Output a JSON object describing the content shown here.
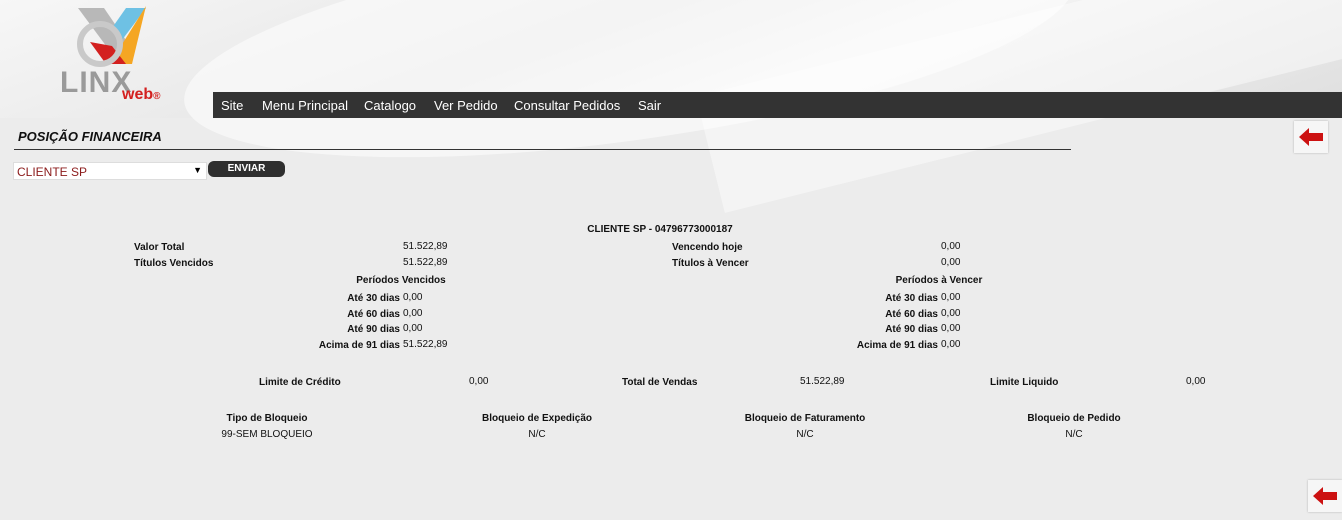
{
  "brand": {
    "name": "LINX",
    "sub": "web",
    "mark": "®"
  },
  "nav": [
    "Site",
    "Menu Principal",
    "Catalogo",
    "Ver Pedido",
    "Consultar Pedidos",
    "Sair"
  ],
  "page_title": "POSIÇÃO FINANCEIRA",
  "filter": {
    "selected": "CLIENTE SP",
    "send_label": "ENVIAR"
  },
  "report": {
    "client_header": "CLIENTE SP - 04796773000187",
    "valor_total": {
      "label": "Valor Total",
      "value": "51.522,89"
    },
    "titulos_vencidos": {
      "label": "Títulos Vencidos",
      "value": "51.522,89"
    },
    "vencendo_hoje": {
      "label": "Vencendo hoje",
      "value": "0,00"
    },
    "titulos_a_vencer": {
      "label": "Títulos à Vencer",
      "value": "0,00"
    },
    "periodos_vencidos": {
      "title": "Períodos Vencidos",
      "rows": [
        {
          "label": "Até 30 dias",
          "value": "0,00"
        },
        {
          "label": "Até 60 dias",
          "value": "0,00"
        },
        {
          "label": "Até 90 dias",
          "value": "0,00"
        },
        {
          "label": "Acima de 91 dias",
          "value": "51.522,89"
        }
      ]
    },
    "periodos_a_vencer": {
      "title": "Períodos à Vencer",
      "rows": [
        {
          "label": "Até 30 dias",
          "value": "0,00"
        },
        {
          "label": "Até 60 dias",
          "value": "0,00"
        },
        {
          "label": "Até 90 dias",
          "value": "0,00"
        },
        {
          "label": "Acima de 91 dias",
          "value": "0,00"
        }
      ]
    },
    "limite_credito": {
      "label": "Limite de Crédito",
      "value": "0,00"
    },
    "total_vendas": {
      "label": "Total de Vendas",
      "value": "51.522,89"
    },
    "limite_liquido": {
      "label": "Limite Liquido",
      "value": "0,00"
    },
    "bloqueios": [
      {
        "label": "Tipo de Bloqueio",
        "value": "99-SEM BLOQUEIO"
      },
      {
        "label": "Bloqueio de Expedição",
        "value": "N/C"
      },
      {
        "label": "Bloqueio de Faturamento",
        "value": "N/C"
      },
      {
        "label": "Bloqueio de Pedido",
        "value": "N/C"
      }
    ]
  },
  "colors": {
    "nav_bg": "#333333",
    "accent_red": "#d3201f",
    "logo_orange": "#f5a623",
    "back_arrow": "#cc1111"
  },
  "icons": {
    "back": "back-arrow-icon",
    "dropdown": "chevron-down-icon"
  }
}
